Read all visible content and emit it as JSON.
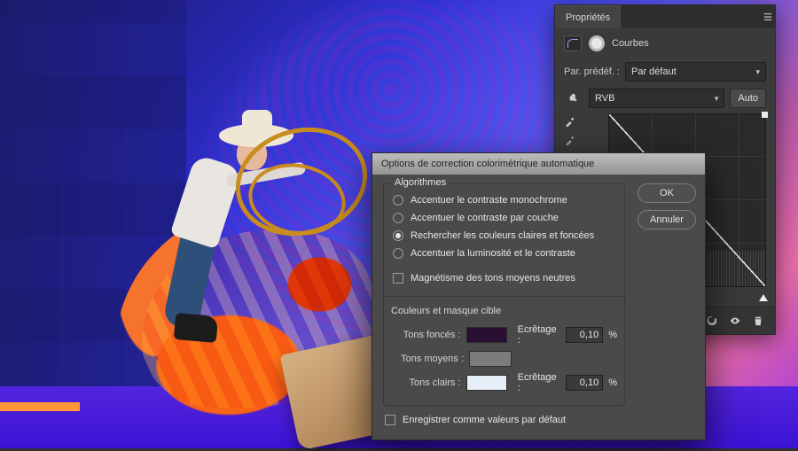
{
  "properties_panel": {
    "tab_label": "Propriétés",
    "adjustment_label": "Courbes",
    "preset_label": "Par. prédéf. :",
    "preset_value": "Par défaut",
    "channel_value": "RVB",
    "auto_label": "Auto"
  },
  "dialog": {
    "title": "Options de correction colorimétrique automatique",
    "algorithms_legend": "Algorithmes",
    "opt_mono": "Accentuer le contraste monochrome",
    "opt_per_channel": "Accentuer le contraste par couche",
    "opt_light_dark": "Rechercher les couleurs claires et foncées",
    "opt_brightness": "Accentuer la luminosité et le contraste",
    "snap_label": "Magnétisme des tons moyens neutres",
    "targets_legend": "Couleurs et masque cible",
    "shadows_label": "Tons foncés :",
    "midtones_label": "Tons moyens :",
    "highlights_label": "Tons clairs :",
    "clip_label": "Ecrêtage :",
    "clip_value": "0,10",
    "percent": "%",
    "save_default": "Enregistrer comme valeurs par défaut",
    "ok": "OK",
    "cancel": "Annuler",
    "selected_algorithm": "opt_light_dark"
  }
}
